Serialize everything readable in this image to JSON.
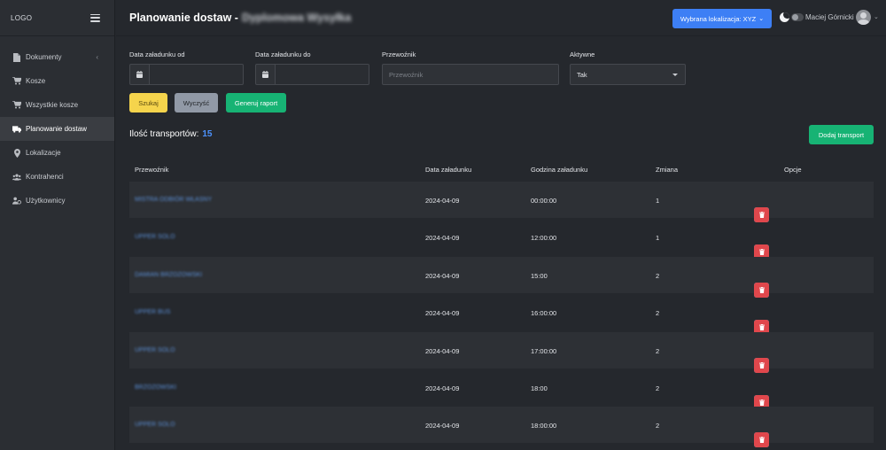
{
  "sidebar": {
    "logo": "LOGO",
    "items": [
      {
        "label": "Dokumenty",
        "icon": "document-icon"
      },
      {
        "label": "Kosze",
        "icon": "cart-icon"
      },
      {
        "label": "Wszystkie kosze",
        "icon": "cart-icon"
      },
      {
        "label": "Planowanie dostaw",
        "icon": "truck-icon",
        "active": true
      },
      {
        "label": "Lokalizacje",
        "icon": "map-pin-icon"
      },
      {
        "label": "Kontrahenci",
        "icon": "users-icon"
      },
      {
        "label": "Użytkownicy",
        "icon": "user-gear-icon"
      }
    ]
  },
  "header": {
    "title": "Planowanie dostaw -",
    "title_suffix": "Dyplomowa Wysyłka",
    "location_button": "Wybrana lokalizacja: XYZ",
    "user_name": "Maciej Górnicki"
  },
  "filters": {
    "date_from_label": "Data załadunku od",
    "date_to_label": "Data załadunku do",
    "carrier_label": "Przewoźnik",
    "carrier_placeholder": "Przewoźnik",
    "active_label": "Aktywne",
    "active_value": "Tak"
  },
  "actions": {
    "search": "Szukaj",
    "clear": "Wyczyść",
    "report": "Generuj raport",
    "add": "Dodaj transport"
  },
  "summary": {
    "label": "Ilość transportów:",
    "count": "15"
  },
  "table": {
    "headers": [
      "Przewoźnik",
      "Data załadunku",
      "Godzina załadunku",
      "Zmiana",
      "Opcje"
    ],
    "rows": [
      {
        "carrier": "Mistra Odbiór Własny",
        "date": "2024-04-09",
        "time": "00:00:00",
        "shift": "1"
      },
      {
        "carrier": "Upper Solo",
        "date": "2024-04-09",
        "time": "12:00:00",
        "shift": "1"
      },
      {
        "carrier": "Damian Brzozowski",
        "date": "2024-04-09",
        "time": "15:00",
        "shift": "2"
      },
      {
        "carrier": "Upper Bus",
        "date": "2024-04-09",
        "time": "16:00:00",
        "shift": "2"
      },
      {
        "carrier": "Upper Solo",
        "date": "2024-04-09",
        "time": "17:00:00",
        "shift": "2"
      },
      {
        "carrier": "Brzozowski",
        "date": "2024-04-09",
        "time": "18:00",
        "shift": "2"
      },
      {
        "carrier": "Upper Solo",
        "date": "2024-04-09",
        "time": "18:00:00",
        "shift": "2"
      }
    ]
  },
  "colors": {
    "accent_blue": "#3d7ff5",
    "success_green": "#17b374",
    "warning_yellow": "#f5d44c",
    "danger_red": "#e0474c"
  }
}
